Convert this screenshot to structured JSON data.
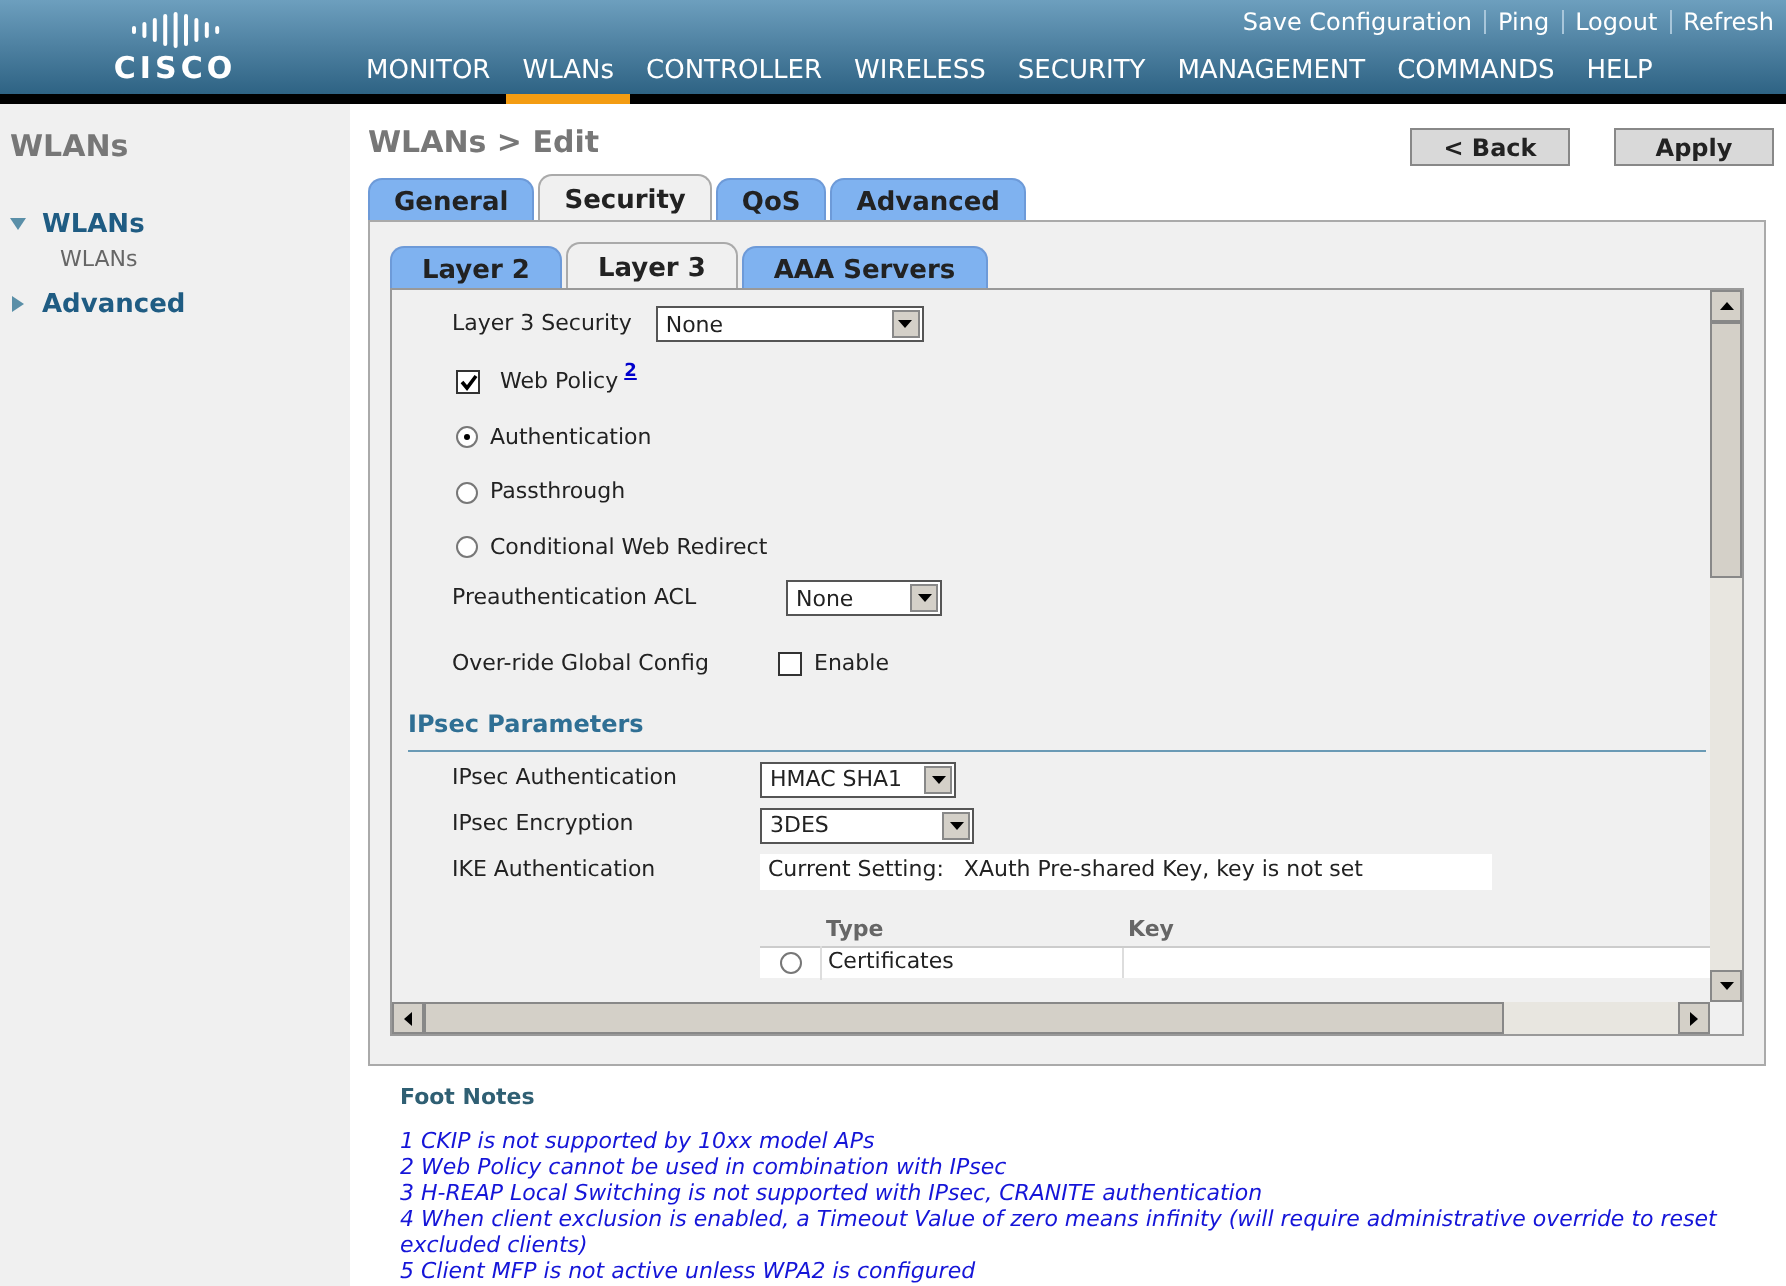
{
  "header": {
    "logo_text": "CISCO",
    "links": [
      {
        "label": "Save Configuration"
      },
      {
        "label": "Ping"
      },
      {
        "label": "Logout"
      },
      {
        "label": "Refresh"
      }
    ],
    "nav": [
      {
        "label": "MONITOR",
        "selected": false
      },
      {
        "label": "WLANs",
        "selected": true
      },
      {
        "label": "CONTROLLER",
        "selected": false
      },
      {
        "label": "WIRELESS",
        "selected": false
      },
      {
        "label": "SECURITY",
        "selected": false
      },
      {
        "label": "MANAGEMENT",
        "selected": false
      },
      {
        "label": "COMMANDS",
        "selected": false
      },
      {
        "label": "HELP",
        "selected": false
      }
    ]
  },
  "sidebar": {
    "title": "WLANs",
    "items": [
      {
        "label": "WLANs",
        "expanded": true,
        "children": [
          {
            "label": "WLANs"
          }
        ]
      },
      {
        "label": "Advanced",
        "expanded": false
      }
    ]
  },
  "page": {
    "title": "WLANs > Edit",
    "buttons": [
      "< Back",
      "Apply"
    ]
  },
  "tabs": [
    {
      "label": "General",
      "selected": false
    },
    {
      "label": "Security",
      "selected": true
    },
    {
      "label": "QoS",
      "selected": false
    },
    {
      "label": "Advanced",
      "selected": false
    }
  ],
  "subtabs": [
    {
      "label": "Layer 2",
      "selected": false
    },
    {
      "label": "Layer 3",
      "selected": true
    },
    {
      "label": "AAA Servers",
      "selected": false
    }
  ],
  "form": {
    "layer3_security": {
      "label": "Layer 3 Security",
      "value": "None"
    },
    "web_policy": {
      "label": "Web Policy",
      "checked": true,
      "footnote": "2"
    },
    "web_policy_options": [
      {
        "label": "Authentication",
        "selected": true
      },
      {
        "label": "Passthrough",
        "selected": false
      },
      {
        "label": "Conditional Web Redirect",
        "selected": false
      }
    ],
    "preauth_acl": {
      "label": "Preauthentication ACL",
      "value": "None"
    },
    "override": {
      "label": "Over-ride Global Config",
      "checked": false,
      "option": "Enable"
    },
    "ipsec_title": "IPsec Parameters",
    "ipsec_fields": [
      {
        "kind": "select",
        "label": "IPsec Authentication",
        "value": "HMAC SHA1"
      },
      {
        "kind": "select",
        "label": "IPsec Encryption",
        "value": "3DES"
      },
      {
        "kind": "setting",
        "label": "IKE Authentication",
        "prefix": "Current Setting:",
        "value": "XAuth Pre-shared Key, key is not set"
      }
    ],
    "key_table": {
      "columns": [
        "Type",
        "Key"
      ],
      "rows": [
        {
          "type": "Certificates",
          "selected": false
        }
      ]
    }
  },
  "footnotes": {
    "title": "Foot Notes",
    "items": [
      "1 CKIP is not supported by 10xx model APs",
      "2 Web Policy cannot be used in combination with IPsec",
      "3 H-REAP Local Switching is not supported with IPsec, CRANITE authentication",
      "4 When client exclusion is enabled, a Timeout Value of zero means infinity (will require administrative override to reset excluded clients)",
      "5 Client MFP is not active unless WPA2 is configured"
    ]
  }
}
